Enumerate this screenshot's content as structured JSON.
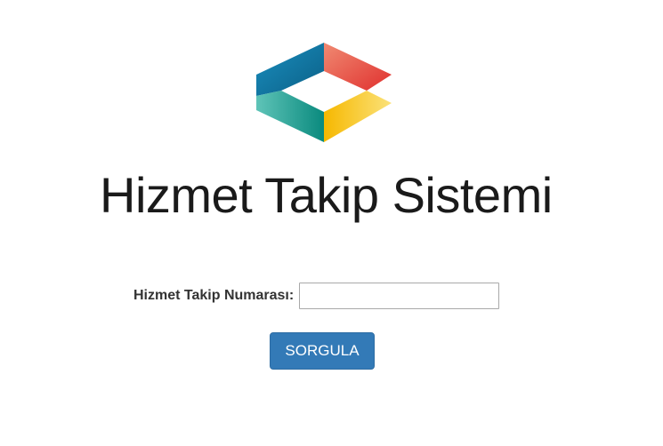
{
  "header": {
    "logo_icon": "hexagon-logo-icon",
    "title": "Hizmet Takip Sistemi"
  },
  "form": {
    "tracking_label": "Hizmet Takip Numarası:",
    "tracking_value": "",
    "tracking_placeholder": "",
    "submit_label": "SORGULA"
  },
  "colors": {
    "button_background": "#337ab7",
    "logo_teal": "#1a9e9a",
    "logo_blue": "#1f8fb8",
    "logo_red": "#e0453a",
    "logo_yellow": "#f5c400"
  }
}
